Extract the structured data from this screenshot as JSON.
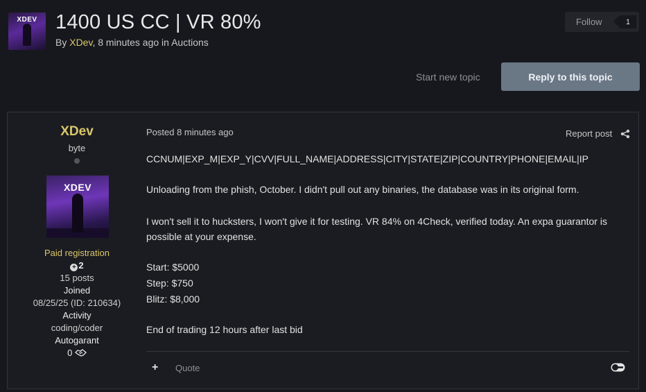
{
  "topic": {
    "title": "1400 US CC | VR 80%",
    "by_prefix": "By ",
    "author": "XDev",
    "meta_suffix": ", 8 minutes ago in ",
    "forum": "Auctions",
    "avatar_label": "XDEV"
  },
  "follow": {
    "label": "Follow",
    "count": "1"
  },
  "actions": {
    "start_new_topic": "Start new topic",
    "reply": "Reply to this topic"
  },
  "author_panel": {
    "name": "XDev",
    "rank": "byte",
    "avatar_label": "XDEV",
    "group": "Paid registration",
    "reputation": "2",
    "posts": "15 posts",
    "joined_label": "Joined",
    "joined_value": "08/25/25 (ID: 210634)",
    "activity_label": "Activity",
    "activity_value": "coding/coder",
    "autogarant_label": "Autogarant",
    "autogarant_value": "0"
  },
  "post": {
    "posted": "Posted 8 minutes ago",
    "report": "Report post",
    "lines": [
      "CCNUM|EXP_M|EXP_Y|CVV|FULL_NAME|ADDRESS|CITY|STATE|ZIP|COUNTRY|PHONE|EMAIL|IP",
      "Unloading from the phish, October. I didn't pull out any binaries, the database was in its original form.",
      "I won't sell it to hucksters, I won't give it for testing. VR 84% on 4Check, verified today. An expa guarantor is possible at your expense.",
      "Start: $5000",
      "Step: $750",
      "Blitz: $8,000",
      "End of trading 12 hours after last bid"
    ],
    "quote": "Quote"
  },
  "icons": [
    "share-icon",
    "plus-icon",
    "handshake-icon",
    "toggle-icon",
    "reputation-plus-icon",
    "online-status-icon"
  ],
  "colors": {
    "author_gold": "#d9c76a",
    "reply_button": "#6a7785",
    "background": "#17181d"
  }
}
